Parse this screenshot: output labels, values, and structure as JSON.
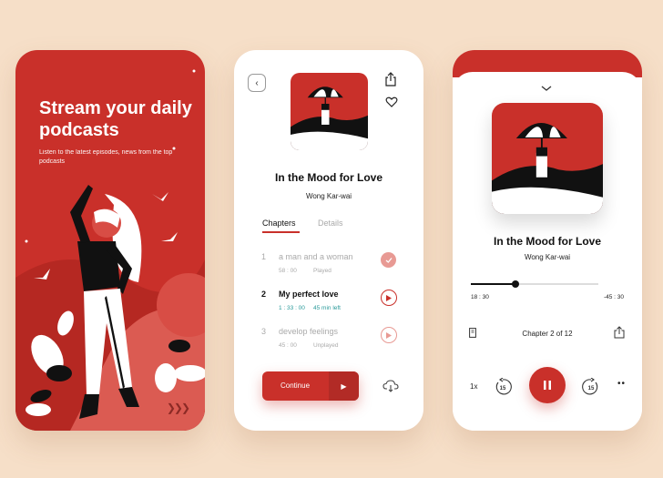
{
  "onboarding": {
    "title": "Stream your daily podcasts",
    "subtitle": "Listen to the latest episodes, news from the top podcasts",
    "next_icon": "triple-chevron-right-icon"
  },
  "details": {
    "title": "In the Mood for Love",
    "author": "Wong Kar-wai",
    "tabs": [
      "Chapters",
      "Details"
    ],
    "chapters": [
      {
        "num": "1",
        "name": "a man and a woman",
        "time": "58 : 00",
        "state": "Played",
        "status": "played"
      },
      {
        "num": "2",
        "name": "My perfect love",
        "time": "1 : 33 : 00",
        "state": "45 min left",
        "status": "current"
      },
      {
        "num": "3",
        "name": "develop feelings",
        "time": "45 : 00",
        "state": "Unplayed",
        "status": "unplayed"
      }
    ],
    "continue_label": "Continue"
  },
  "player": {
    "title": "In the Mood for Love",
    "author": "Wong Kar-wai",
    "elapsed": "18 : 30",
    "remaining": "-45 : 30",
    "progress": 0.35,
    "chapter": "Chapter 2 of 12",
    "speed": "1x",
    "skip_back": "15",
    "skip_forward": "15"
  },
  "colors": {
    "accent": "#c9302a",
    "background": "#f6dfc8"
  }
}
